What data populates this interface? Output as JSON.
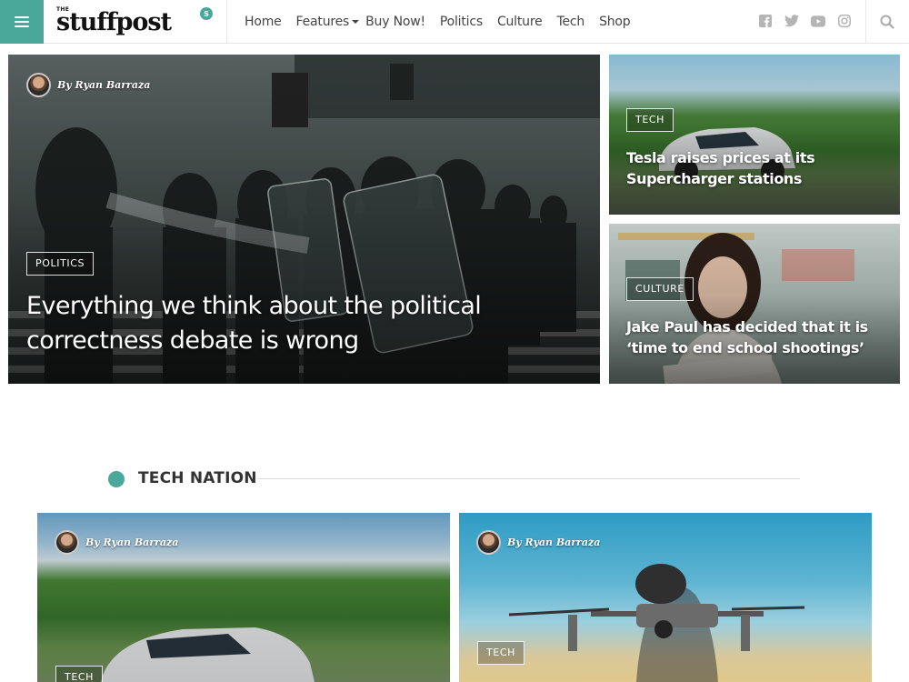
{
  "header": {
    "menu_icon": "hamburger-icon",
    "logo_small": "THE",
    "logo_main": "stuffpost",
    "logo_badge": "S",
    "brand_color": "#4aa89a",
    "nav": [
      {
        "label": "Home"
      },
      {
        "label": "Features",
        "has_dropdown": true
      },
      {
        "label": "Buy Now!"
      },
      {
        "label": "Politics"
      },
      {
        "label": "Culture"
      },
      {
        "label": "Tech"
      },
      {
        "label": "Shop"
      }
    ],
    "social_icons": [
      "facebook-icon",
      "twitter-icon",
      "youtube-icon",
      "instagram-icon"
    ],
    "search_icon": "search-icon"
  },
  "hero": {
    "main": {
      "author": "By Ryan Barraza",
      "category": "POLITICS",
      "title_line1": "Everything we think about the political",
      "title_line2": "correctness debate is wrong"
    },
    "side_top": {
      "category": "TECH",
      "title_line1": "Tesla raises prices at its",
      "title_line2": "Supercharger stations"
    },
    "side_bottom": {
      "category": "CULTURE",
      "title_line1": "Jake Paul has decided that it is",
      "title_line2": "‘time to end school shootings’"
    }
  },
  "section": {
    "title": "TECH NATION",
    "cards": [
      {
        "author": "By Ryan Barraza",
        "category": "TECH"
      },
      {
        "author": "By Ryan Barraza",
        "category": "TECH"
      }
    ]
  }
}
